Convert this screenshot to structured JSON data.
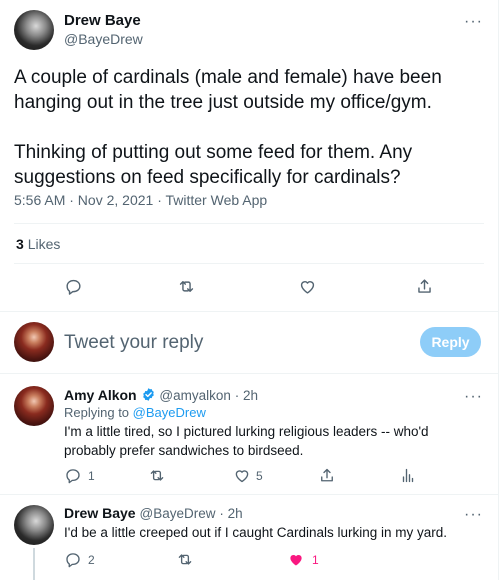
{
  "tweet": {
    "author_name": "Drew Baye",
    "author_handle": "@BayeDrew",
    "paragraph1": "A couple of cardinals (male and female) have been hanging out in the tree just outside my office/gym.",
    "paragraph2": "Thinking of putting out some feed for them. Any suggestions on feed specifically for cardinals?",
    "meta": "5:56 AM · Nov 2, 2021 · Twitter Web App",
    "likes_count": "3",
    "likes_label": "Likes"
  },
  "composer": {
    "placeholder": "Tweet your reply",
    "reply_button": "Reply"
  },
  "replies": [
    {
      "author_name": "Amy Alkon",
      "author_handle": "@amyalkon",
      "time": "· 2h",
      "replying_prefix": "Replying to",
      "replying_to": "@BayeDrew",
      "text": "I'm a little tired, so I pictured lurking religious leaders -- who'd probably prefer sandwiches to birdseed.",
      "reply_count": "1",
      "retweet_count": "",
      "like_count": "5"
    },
    {
      "author_name": "Drew Baye",
      "author_handle": "@BayeDrew",
      "time": "· 2h",
      "text": "I'd be a little creeped out if I caught Cardinals lurking in my yard.",
      "reply_count": "2",
      "retweet_count": "",
      "like_count": "1"
    }
  ],
  "colors": {
    "accent": "#1d9bf0",
    "reply_button_disabled": "#8ecdf8",
    "like_pink": "#f91880",
    "muted_text": "#536471"
  },
  "icons": [
    "more-icon",
    "reply-icon",
    "retweet-icon",
    "like-icon",
    "share-icon",
    "analytics-icon",
    "verified-icon"
  ]
}
